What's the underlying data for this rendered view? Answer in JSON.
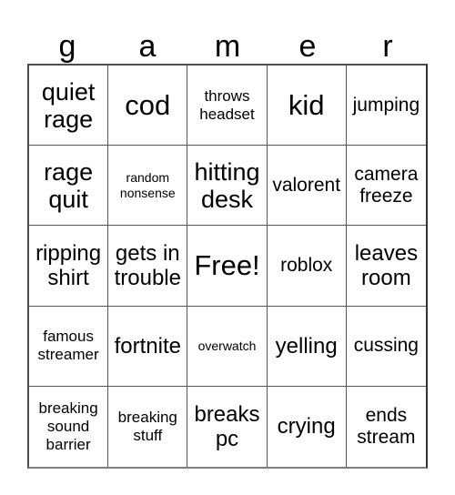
{
  "card": {
    "header_letters": [
      "g",
      "a",
      "m",
      "e",
      "r"
    ],
    "rows": [
      [
        {
          "text": "quiet rage",
          "size": "lg"
        },
        {
          "text": "cod",
          "size": "xl"
        },
        {
          "text": "throws headset",
          "size": "xs"
        },
        {
          "text": "kid",
          "size": "xl"
        },
        {
          "text": "jumping",
          "size": "sm"
        }
      ],
      [
        {
          "text": "rage quit",
          "size": "lg"
        },
        {
          "text": "random nonsense",
          "size": "xxs"
        },
        {
          "text": "hitting desk",
          "size": "lg"
        },
        {
          "text": "valorent",
          "size": "sm"
        },
        {
          "text": "camera freeze",
          "size": "sm"
        }
      ],
      [
        {
          "text": "ripping shirt",
          "size": "md"
        },
        {
          "text": "gets in trouble",
          "size": "md"
        },
        {
          "text": "Free!",
          "size": "xl"
        },
        {
          "text": "roblox",
          "size": "sm"
        },
        {
          "text": "leaves room",
          "size": "md"
        }
      ],
      [
        {
          "text": "famous streamer",
          "size": "xs"
        },
        {
          "text": "fortnite",
          "size": "md"
        },
        {
          "text": "overwatch",
          "size": "xxs"
        },
        {
          "text": "yelling",
          "size": "md"
        },
        {
          "text": "cussing",
          "size": "sm"
        }
      ],
      [
        {
          "text": "breaking sound barrier",
          "size": "xs"
        },
        {
          "text": "breaking stuff",
          "size": "xs"
        },
        {
          "text": "breaks pc",
          "size": "md"
        },
        {
          "text": "crying",
          "size": "md"
        },
        {
          "text": "ends stream",
          "size": "sm"
        }
      ]
    ],
    "free_space_text": "Free!",
    "colors": {
      "background": "#ffffff",
      "text": "#000000",
      "grid_line": "#555555",
      "grid_outer": "#4d4d4d"
    }
  }
}
